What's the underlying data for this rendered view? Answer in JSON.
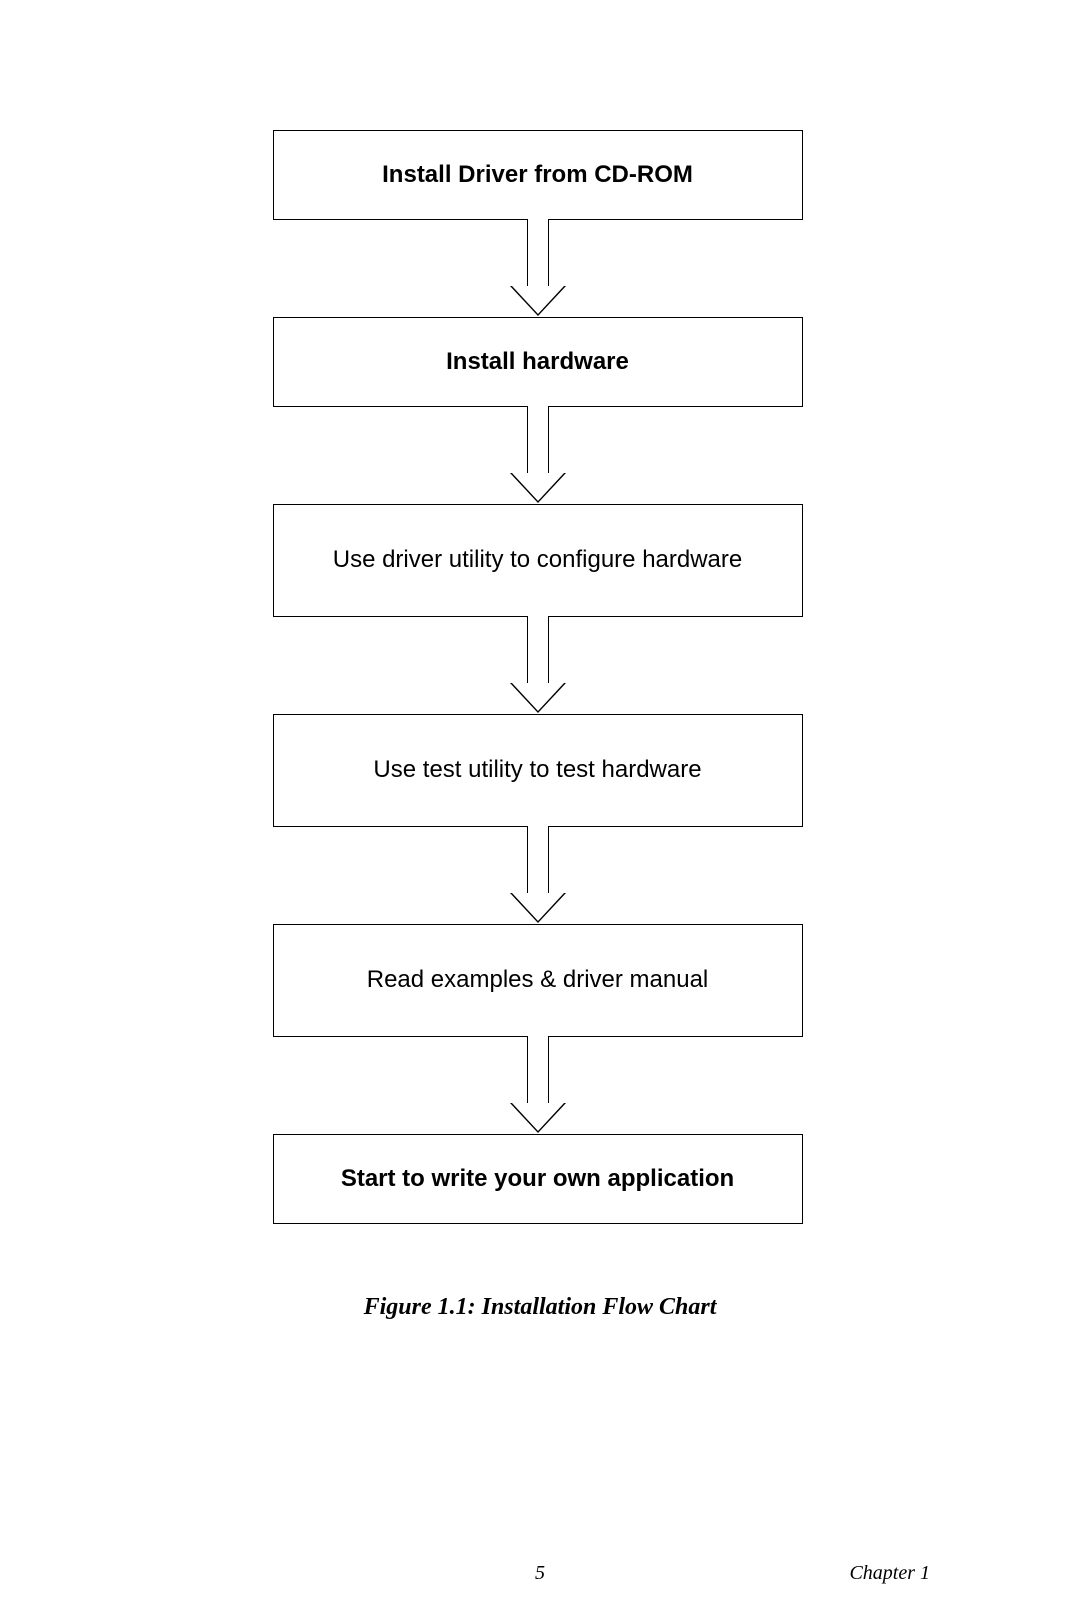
{
  "chart_data": {
    "type": "flowchart",
    "title": "Figure 1.1: Installation Flow Chart",
    "steps": [
      {
        "label": "Install Driver from CD-ROM",
        "emphasis": "bold"
      },
      {
        "label": "Install hardware",
        "emphasis": "bold"
      },
      {
        "label": "Use driver utility to configure hardware",
        "emphasis": "normal"
      },
      {
        "label": "Use test utility to test hardware",
        "emphasis": "normal"
      },
      {
        "label": "Read examples & driver manual",
        "emphasis": "normal"
      },
      {
        "label": "Start to write your own application",
        "emphasis": "bold"
      }
    ]
  },
  "caption": "Figure 1.1: Installation Flow Chart",
  "footer": {
    "page_number": "5",
    "chapter": "Chapter 1"
  }
}
